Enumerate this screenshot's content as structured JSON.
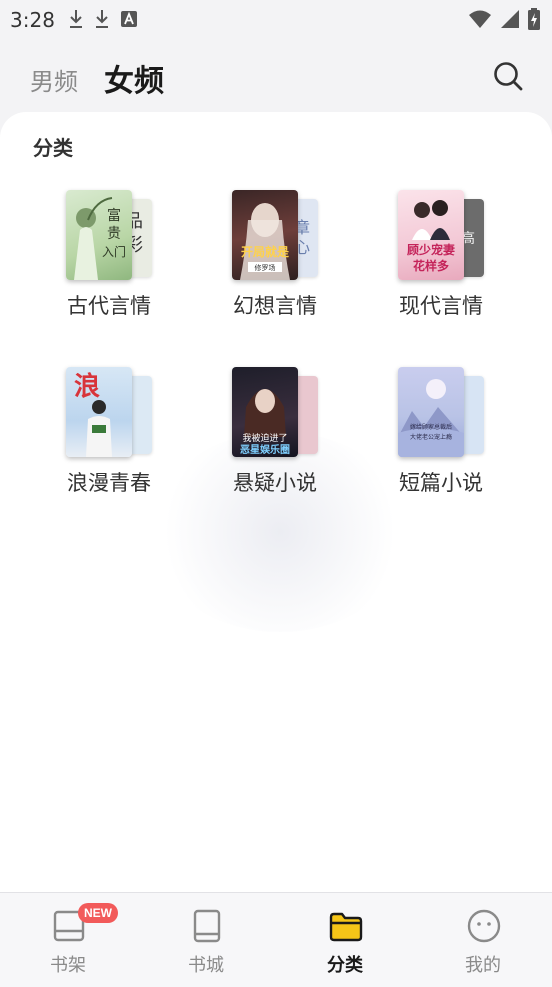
{
  "status": {
    "time": "3:28",
    "left_icons": [
      "download-icon",
      "download-icon",
      "font-app-icon"
    ],
    "right_icons": [
      "wifi-icon",
      "signal-icon",
      "battery-charging-icon"
    ]
  },
  "header": {
    "tabs": [
      {
        "label": "男频",
        "active": false
      },
      {
        "label": "女频",
        "active": true
      }
    ],
    "search_icon": "search-icon"
  },
  "section": {
    "title": "分类"
  },
  "categories": [
    {
      "label": "古代言情",
      "cover_text": "富贵\n入门",
      "back_text": "品",
      "front_color": "#cfe3c1",
      "back_color": "#e9ece3"
    },
    {
      "label": "幻想言情",
      "cover_text": "开局就是",
      "back_text": "章",
      "front_color": "#5a3a3a",
      "back_color": "#dfe6f2"
    },
    {
      "label": "现代言情",
      "cover_text": "顾少宠妻\n花样多",
      "back_text": "高",
      "front_color": "#f3c9d6",
      "back_color": "#6c6c6c"
    },
    {
      "label": "浪漫青春",
      "cover_text": "浪",
      "back_text": "",
      "front_color": "#cfe0f2",
      "back_color": "#dce9f4"
    },
    {
      "label": "悬疑小说",
      "cover_text": "我被迫进了\n恶星娱乐圈",
      "back_text": "",
      "front_color": "#2a2a3a",
      "back_color": "#e9c7cf"
    },
    {
      "label": "短篇小说",
      "cover_text": "嫁给顾家总裁后\n大佬老公宠上瘾",
      "back_text": "",
      "front_color": "#b9c3e6",
      "back_color": "#d7e4f4"
    }
  ],
  "bottom_nav": [
    {
      "label": "书架",
      "icon": "bookshelf-icon",
      "badge": "NEW",
      "active": false
    },
    {
      "label": "书城",
      "icon": "book-icon",
      "badge": "",
      "active": false
    },
    {
      "label": "分类",
      "icon": "folder-icon",
      "badge": "",
      "active": true
    },
    {
      "label": "我的",
      "icon": "smiley-profile-icon",
      "badge": "",
      "active": false
    }
  ],
  "colors": {
    "accent": "#f5c518",
    "badge": "#f25a5a",
    "inactive": "#8a8a8a"
  }
}
